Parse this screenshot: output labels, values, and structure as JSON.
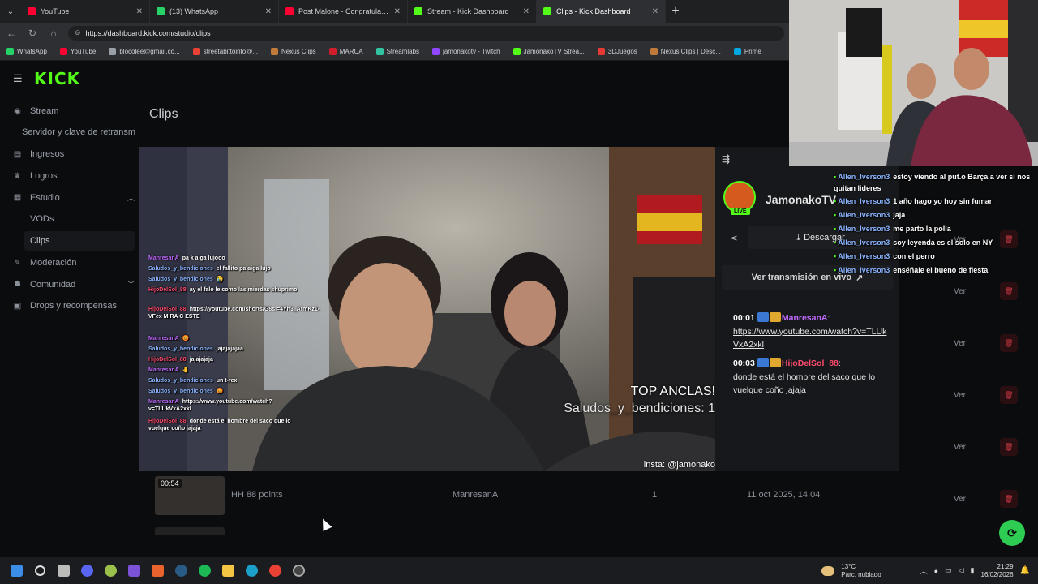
{
  "browser": {
    "tabs": [
      {
        "title": "YouTube",
        "fav_color": "#ff0033"
      },
      {
        "title": "(13) WhatsApp",
        "fav_color": "#25d366"
      },
      {
        "title": "Post Malone - Congratulations (Official Mus",
        "fav_color": "#ff0033"
      },
      {
        "title": "Stream - Kick Dashboard",
        "fav_color": "#53fc18"
      },
      {
        "title": "Clips - Kick Dashboard",
        "fav_color": "#53fc18",
        "active": true
      }
    ],
    "url": "https://dashboard.kick.com/studio/clips",
    "bookmarks": [
      {
        "label": "WhatsApp",
        "color": "#25d366"
      },
      {
        "label": "YouTube",
        "color": "#ff0033"
      },
      {
        "label": "blocolee@gmail.co...",
        "color": "#9aa0a6"
      },
      {
        "label": "streetabittoinfo@...",
        "color": "#ea4335"
      },
      {
        "label": "Nexus Clips",
        "color": "#c07a3a"
      },
      {
        "label": "MARCA",
        "color": "#d01f2a"
      },
      {
        "label": "Streamlabs",
        "color": "#31c3a2"
      },
      {
        "label": "jamonakotv - Twitch",
        "color": "#9146ff"
      },
      {
        "label": "JamonakoTV Strea...",
        "color": "#53fc18"
      },
      {
        "label": "3DJuegos",
        "color": "#e53935"
      },
      {
        "label": "Nexus Clips | Desc...",
        "color": "#c07a3a"
      },
      {
        "label": "Prime",
        "color": "#00a8e1"
      }
    ]
  },
  "app": {
    "logo": "KICK",
    "page_title": "Clips",
    "sidebar": {
      "stream": "Stream",
      "stream_sub": "Servidor y clave de retransm",
      "ingresos": "Ingresos",
      "logros": "Logros",
      "estudio": "Estudio",
      "vods": "VODs",
      "clips": "Clips",
      "moderacion": "Moderación",
      "comunidad": "Comunidad",
      "drops": "Drops y recompensas"
    },
    "table": {
      "ver_label": "Ver",
      "last_row": {
        "duration": "00:54",
        "title": "HH 88 points",
        "creator": "ManresanA",
        "views": "1",
        "date": "11 oct 2025, 14:04"
      }
    }
  },
  "player": {
    "top_anclas": "TOP ANCLAS!",
    "top_anclas_line": "Saludos_y_bendiciones: 1",
    "watermark": "insta: @jamonako",
    "overlay_chat": [
      {
        "name": "ManresanA",
        "msg": "pa k aiga lujooo",
        "color": "#c06bff"
      },
      {
        "name": "Saludos_y_bendiciones",
        "msg": "el fallito pa aiga lujo",
        "color": "#8ab4ff"
      },
      {
        "name": "Saludos_y_bendiciones",
        "msg": "😭",
        "color": "#8ab4ff"
      },
      {
        "name": "HijoDelSol_88",
        "msg": "ay el falo le como las mierdas shuprimo",
        "color": "#ff4b6e"
      },
      {
        "name": "HijoDelSol_88",
        "msg": "https://youtube.com/shorts/G8si=4Yh3_AfmKz1-VFex MIRA C ESTE",
        "color": "#ff4b6e"
      },
      {
        "name": "ManresanA",
        "msg": "😡",
        "color": "#c06bff"
      },
      {
        "name": "Saludos_y_bendiciones",
        "msg": "jajajajajaa",
        "color": "#8ab4ff"
      },
      {
        "name": "HijoDelSol_88",
        "msg": "jajajajaja",
        "color": "#ff4b6e"
      },
      {
        "name": "ManresanA",
        "msg": "🤚",
        "color": "#c06bff"
      },
      {
        "name": "Saludos_y_bendiciones",
        "msg": "un t-rex",
        "color": "#8ab4ff"
      },
      {
        "name": "Saludos_y_bendiciones",
        "msg": "😡",
        "color": "#8ab4ff"
      },
      {
        "name": "ManresanA",
        "msg": "https://www.youtube.com/watch?v=TLUkVxA2xkl",
        "color": "#c06bff"
      },
      {
        "name": "HijoDelSol_88",
        "msg": "donde está el hombre del saco que lo vuelque coño jajaja",
        "color": "#ff4b6e"
      }
    ]
  },
  "panel": {
    "channel": "JamonakoTV",
    "live": "LIVE",
    "download": "Descargar",
    "watch_live": "Ver transmisión en vivo",
    "chat": [
      {
        "time": "00:01",
        "name": "ManresanA",
        "color": "#c06bff",
        "text": "https://www.youtube.com/watch?v=TLUkVxA2xkl",
        "link": true
      },
      {
        "time": "00:03",
        "name": "HijoDelSol_88",
        "color": "#ff4b6e",
        "text": "donde está el hombre del saco que lo vuelque coño jajaja",
        "link": false
      }
    ]
  },
  "webcam_chat": [
    {
      "name": "Allen_Iverson3",
      "msg": "estoy viendo al put.o Barça a ver si nos quitan lideres"
    },
    {
      "name": "Allen_Iverson3",
      "msg": "1 año hago yo hoy sin fumar"
    },
    {
      "name": "Allen_Iverson3",
      "msg": "jaja"
    },
    {
      "name": "Allen_Iverson3",
      "msg": "me parto la polla"
    },
    {
      "name": "Allen_Iverson3",
      "msg": "soy leyenda es el solo en NY"
    },
    {
      "name": "Allen_Iverson3",
      "msg": "con el perro"
    },
    {
      "name": "Allen_Iverson3",
      "msg": "enséñale el bueno de fiesta"
    }
  ],
  "taskbar": {
    "weather_temp": "13°C",
    "weather_desc": "Parc. nublado",
    "time": "21:29",
    "date": "16/02/2026"
  }
}
